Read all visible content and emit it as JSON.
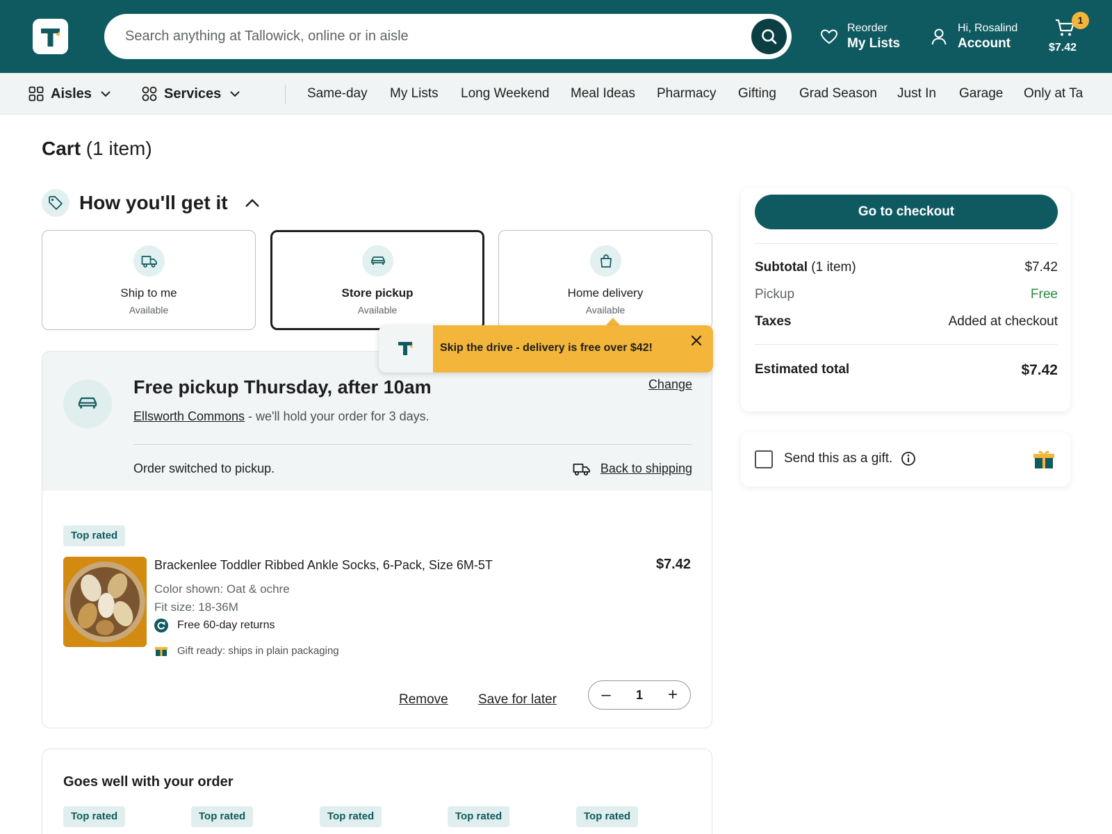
{
  "header": {
    "search_placeholder": "Search anything at Tallowick, online or in aisle",
    "reorder_small": "Reorder",
    "reorder_big": "My Lists",
    "account_small": "Hi, Rosalind",
    "account_big": "Account",
    "cart_count": "1",
    "cart_total": "$7.42"
  },
  "subnav": {
    "aisles": "Aisles",
    "services": "Services",
    "links": [
      "Same-day",
      "My Lists",
      "Long Weekend",
      "Meal Ideas",
      "Pharmacy",
      "Gifting",
      "Grad Season",
      "Just In",
      "Garage",
      "Only at Ta"
    ]
  },
  "cart": {
    "title_bold": "Cart",
    "title_rest": " (1 item)",
    "how_title": "How you'll get it"
  },
  "fulfillment": [
    {
      "name": "Ship to me",
      "status": "Available",
      "icon": "truck-icon"
    },
    {
      "name": "Store pickup",
      "status": "Available",
      "icon": "car-icon"
    },
    {
      "name": "Home delivery",
      "status": "Available",
      "icon": "bag-icon"
    }
  ],
  "toast": {
    "message": "Skip the drive - delivery is free over $42!"
  },
  "pickup": {
    "title": "Free pickup Thursday, after 10am",
    "change": "Change",
    "store": "Ellsworth Commons",
    "hold": " - we'll hold your order for 3 days.",
    "switched": "Order switched to pickup.",
    "back": "Back to shipping"
  },
  "item": {
    "badge": "Top rated",
    "name": "Brackenlee Toddler Ribbed Ankle Socks, 6-Pack, Size 6M-5T",
    "price": "$7.42",
    "color": "Color shown: Oat & ochre",
    "fit": "Fit size: 18-36M",
    "returns": "Free 60-day returns",
    "gift_ready": "Gift ready: ships in plain packaging",
    "remove": "Remove",
    "save": "Save for later",
    "qty": "1"
  },
  "goes_well": {
    "title": "Goes well with your order",
    "badges": [
      "Top rated",
      "Top rated",
      "Top rated",
      "Top rated",
      "Top rated"
    ]
  },
  "summary": {
    "checkout": "Go to checkout",
    "subtotal_label": "Subtotal",
    "subtotal_count": " (1 item)",
    "subtotal": "$7.42",
    "pickup_label": "Pickup",
    "pickup_value": "Free",
    "taxes_label": "Taxes",
    "taxes_value": "Added at checkout",
    "estimated_label": "Estimated total",
    "estimated_value": "$7.42"
  },
  "gift": {
    "label": "Send this as a gift."
  },
  "colors": {
    "brand": "#0f5a60",
    "accent": "#f3b63a",
    "free": "#2a8a3e"
  }
}
